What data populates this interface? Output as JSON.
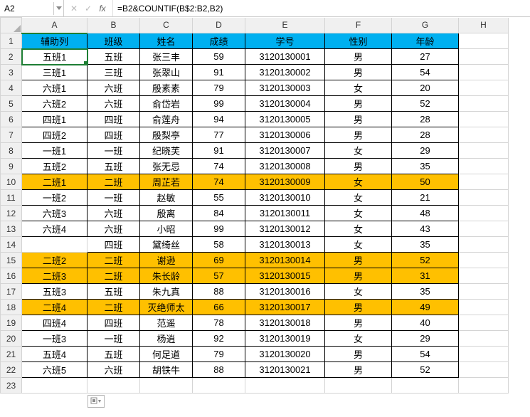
{
  "formula_bar": {
    "cell_ref": "A2",
    "cancel_glyph": "✕",
    "confirm_glyph": "✓",
    "fx_label": "fx",
    "formula": "=B2&COUNTIF(B$2:B2,B2)"
  },
  "columns": [
    "A",
    "B",
    "C",
    "D",
    "E",
    "F",
    "G",
    "H"
  ],
  "rows_count": 23,
  "header_row": {
    "a": "辅助列",
    "b": "班级",
    "c": "姓名",
    "d": "成绩",
    "e": "学号",
    "f": "性别",
    "g": "年龄"
  },
  "data": [
    {
      "a": "五班1",
      "b": "五班",
      "c": "张三丰",
      "d": "59",
      "e": "3120130001",
      "f": "男",
      "g": "27",
      "hl": false
    },
    {
      "a": "三班1",
      "b": "三班",
      "c": "张翠山",
      "d": "91",
      "e": "3120130002",
      "f": "男",
      "g": "54",
      "hl": false
    },
    {
      "a": "六班1",
      "b": "六班",
      "c": "殷素素",
      "d": "79",
      "e": "3120130003",
      "f": "女",
      "g": "20",
      "hl": false
    },
    {
      "a": "六班2",
      "b": "六班",
      "c": "俞岱岩",
      "d": "99",
      "e": "3120130004",
      "f": "男",
      "g": "52",
      "hl": false
    },
    {
      "a": "四班1",
      "b": "四班",
      "c": "俞莲舟",
      "d": "94",
      "e": "3120130005",
      "f": "男",
      "g": "28",
      "hl": false
    },
    {
      "a": "四班2",
      "b": "四班",
      "c": "殷梨亭",
      "d": "77",
      "e": "3120130006",
      "f": "男",
      "g": "28",
      "hl": false
    },
    {
      "a": "一班1",
      "b": "一班",
      "c": "纪晓芙",
      "d": "91",
      "e": "3120130007",
      "f": "女",
      "g": "29",
      "hl": false
    },
    {
      "a": "五班2",
      "b": "五班",
      "c": "张无忌",
      "d": "74",
      "e": "3120130008",
      "f": "男",
      "g": "35",
      "hl": false
    },
    {
      "a": "二班1",
      "b": "二班",
      "c": "周芷若",
      "d": "74",
      "e": "3120130009",
      "f": "女",
      "g": "50",
      "hl": true
    },
    {
      "a": "一班2",
      "b": "一班",
      "c": "赵敏",
      "d": "55",
      "e": "3120130010",
      "f": "女",
      "g": "21",
      "hl": false
    },
    {
      "a": "六班3",
      "b": "六班",
      "c": "殷离",
      "d": "84",
      "e": "3120130011",
      "f": "女",
      "g": "48",
      "hl": false
    },
    {
      "a": "六班4",
      "b": "六班",
      "c": "小昭",
      "d": "99",
      "e": "3120130012",
      "f": "女",
      "g": "43",
      "hl": false
    },
    {
      "a": "",
      "b": "四班",
      "c": "黛绮丝",
      "d": "58",
      "e": "3120130013",
      "f": "女",
      "g": "35",
      "hl": false,
      "a_empty": true
    },
    {
      "a": "二班2",
      "b": "二班",
      "c": "谢逊",
      "d": "69",
      "e": "3120130014",
      "f": "男",
      "g": "52",
      "hl": true
    },
    {
      "a": "二班3",
      "b": "二班",
      "c": "朱长龄",
      "d": "57",
      "e": "3120130015",
      "f": "男",
      "g": "31",
      "hl": true
    },
    {
      "a": "五班3",
      "b": "五班",
      "c": "朱九真",
      "d": "88",
      "e": "3120130016",
      "f": "女",
      "g": "35",
      "hl": false
    },
    {
      "a": "二班4",
      "b": "二班",
      "c": "灭绝师太",
      "d": "66",
      "e": "3120130017",
      "f": "男",
      "g": "49",
      "hl": true
    },
    {
      "a": "四班4",
      "b": "四班",
      "c": "范遥",
      "d": "78",
      "e": "3120130018",
      "f": "男",
      "g": "40",
      "hl": false
    },
    {
      "a": "一班3",
      "b": "一班",
      "c": "杨逍",
      "d": "92",
      "e": "3120130019",
      "f": "女",
      "g": "29",
      "hl": false
    },
    {
      "a": "五班4",
      "b": "五班",
      "c": "何足道",
      "d": "79",
      "e": "3120130020",
      "f": "男",
      "g": "54",
      "hl": false
    },
    {
      "a": "六班5",
      "b": "六班",
      "c": "胡铁牛",
      "d": "88",
      "e": "3120130021",
      "f": "男",
      "g": "52",
      "hl": false
    }
  ],
  "chart_data": {
    "type": "table",
    "title": "",
    "columns": [
      "辅助列",
      "班级",
      "姓名",
      "成绩",
      "学号",
      "性别",
      "年龄"
    ],
    "rows": [
      [
        "五班1",
        "五班",
        "张三丰",
        59,
        "3120130001",
        "男",
        27
      ],
      [
        "三班1",
        "三班",
        "张翠山",
        91,
        "3120130002",
        "男",
        54
      ],
      [
        "六班1",
        "六班",
        "殷素素",
        79,
        "3120130003",
        "女",
        20
      ],
      [
        "六班2",
        "六班",
        "俞岱岩",
        99,
        "3120130004",
        "男",
        52
      ],
      [
        "四班1",
        "四班",
        "俞莲舟",
        94,
        "3120130005",
        "男",
        28
      ],
      [
        "四班2",
        "四班",
        "殷梨亭",
        77,
        "3120130006",
        "男",
        28
      ],
      [
        "一班1",
        "一班",
        "纪晓芙",
        91,
        "3120130007",
        "女",
        29
      ],
      [
        "五班2",
        "五班",
        "张无忌",
        74,
        "3120130008",
        "男",
        35
      ],
      [
        "二班1",
        "二班",
        "周芷若",
        74,
        "3120130009",
        "女",
        50
      ],
      [
        "一班2",
        "一班",
        "赵敏",
        55,
        "3120130010",
        "女",
        21
      ],
      [
        "六班3",
        "六班",
        "殷离",
        84,
        "3120130011",
        "女",
        48
      ],
      [
        "六班4",
        "六班",
        "小昭",
        99,
        "3120130012",
        "女",
        43
      ],
      [
        "",
        "四班",
        "黛绮丝",
        58,
        "3120130013",
        "女",
        35
      ],
      [
        "二班2",
        "二班",
        "谢逊",
        69,
        "3120130014",
        "男",
        52
      ],
      [
        "二班3",
        "二班",
        "朱长龄",
        57,
        "3120130015",
        "男",
        31
      ],
      [
        "五班3",
        "五班",
        "朱九真",
        88,
        "3120130016",
        "女",
        35
      ],
      [
        "二班4",
        "二班",
        "灭绝师太",
        66,
        "3120130017",
        "男",
        49
      ],
      [
        "四班4",
        "四班",
        "范遥",
        78,
        "3120130018",
        "男",
        40
      ],
      [
        "一班3",
        "一班",
        "杨逍",
        92,
        "3120130019",
        "女",
        29
      ],
      [
        "五班4",
        "五班",
        "何足道",
        79,
        "3120130020",
        "男",
        54
      ],
      [
        "六班5",
        "六班",
        "胡铁牛",
        88,
        "3120130021",
        "男",
        52
      ]
    ]
  }
}
